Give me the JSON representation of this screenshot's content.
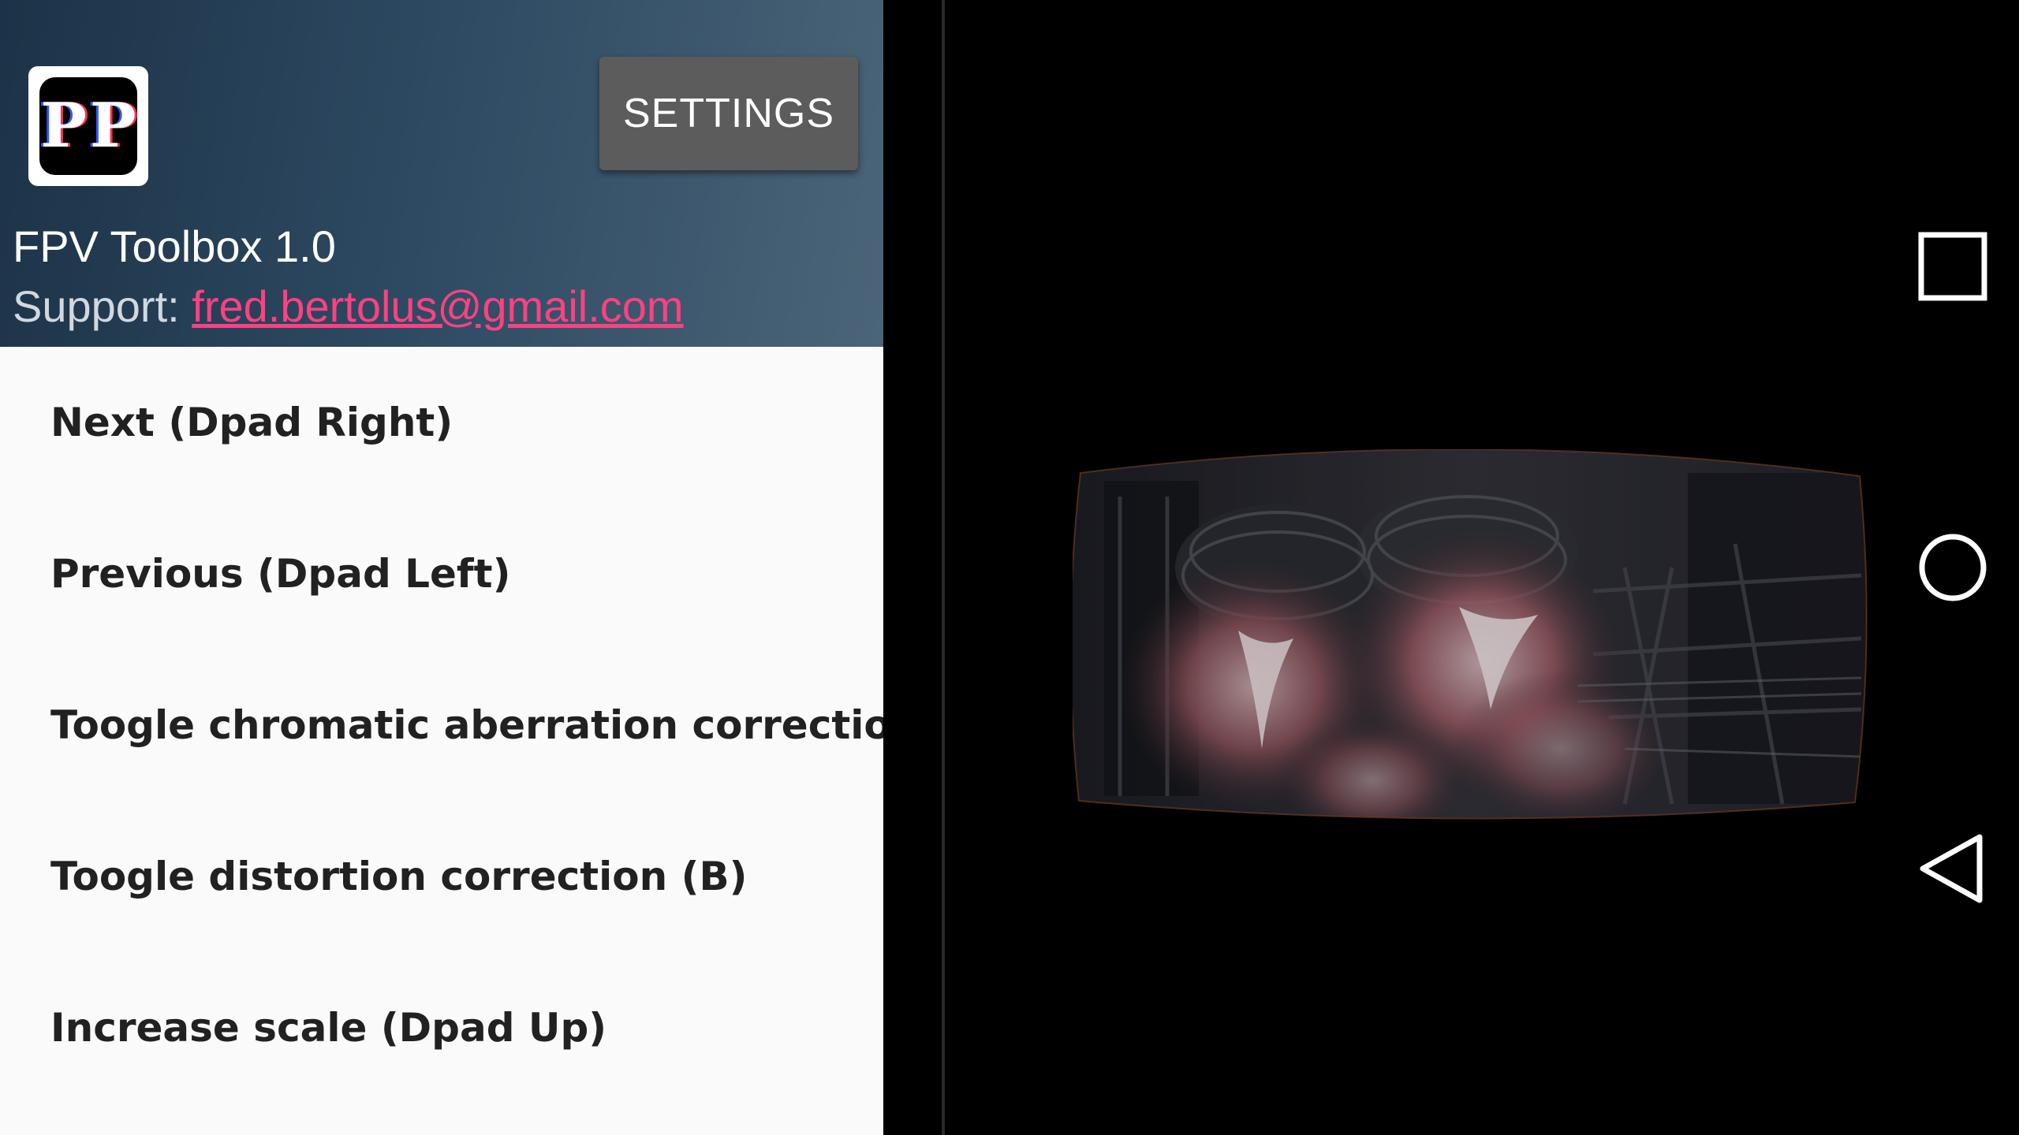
{
  "drawer": {
    "header": {
      "logo_text": "PP",
      "settings_label": "SETTINGS",
      "app_version": "FPV Toolbox 1.0",
      "support_prefix": "Support:",
      "support_email": "fred.bertolus@gmail.com"
    },
    "menu": [
      {
        "label": "Next (Dpad Right)"
      },
      {
        "label": "Previous (Dpad  Left)"
      },
      {
        "label": "Toogle chromatic aberration correction"
      },
      {
        "label": "Toogle distortion correction (B)"
      },
      {
        "label": "Increase scale (Dpad  Up)"
      }
    ]
  },
  "navbar": {
    "icons": [
      "square-recents-icon",
      "circle-home-icon",
      "triangle-back-icon"
    ]
  },
  "colors": {
    "header_gradient_start": "#1c3247",
    "header_gradient_end": "#4b6478",
    "accent_link": "#ff4081",
    "settings_button": "#5c5c5c",
    "drawer_background": "#fafafa"
  }
}
